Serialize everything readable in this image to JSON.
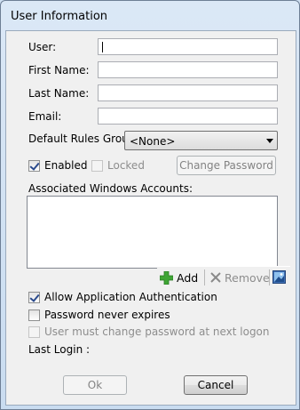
{
  "window": {
    "title": "User Information"
  },
  "fields": {
    "user_label": "User:",
    "user_value": "",
    "first_name_label": "First Name:",
    "first_name_value": "",
    "last_name_label": "Last Name:",
    "last_name_value": "",
    "email_label": "Email:",
    "email_value": ""
  },
  "rules_group": {
    "label": "Default Rules Group:",
    "selected": "<None>"
  },
  "status": {
    "enabled_label": "Enabled",
    "enabled_checked": true,
    "locked_label": "Locked",
    "locked_checked": false,
    "locked_disabled": true,
    "change_password_label": "Change Password"
  },
  "accounts": {
    "label": "Associated Windows Accounts:",
    "items": [],
    "add_label": "Add",
    "remove_label": "Remove"
  },
  "options": {
    "allow_app_auth_label": "Allow Application Authentication",
    "allow_app_auth_checked": true,
    "never_expires_label": "Password never expires",
    "never_expires_checked": false,
    "must_change_label": "User must change password at next logon",
    "must_change_checked": false
  },
  "last_login": {
    "label": "Last Login :",
    "value": ""
  },
  "buttons": {
    "ok_label": "Ok",
    "cancel_label": "Cancel"
  },
  "colors": {
    "add_icon": "#3fa535",
    "remove_icon": "#8a8a8a",
    "title_bar": "#dbe8f6"
  }
}
